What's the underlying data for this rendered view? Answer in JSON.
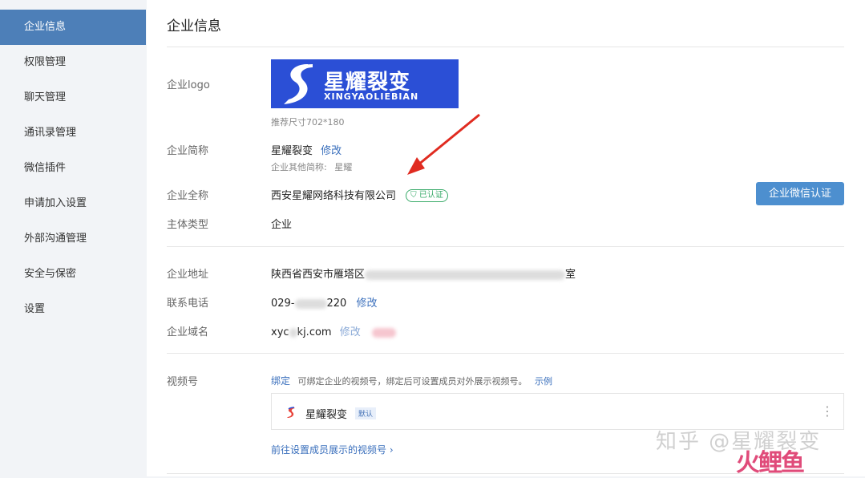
{
  "sidebar": {
    "items": [
      {
        "label": "企业信息"
      },
      {
        "label": "权限管理"
      },
      {
        "label": "聊天管理"
      },
      {
        "label": "通讯录管理"
      },
      {
        "label": "微信插件"
      },
      {
        "label": "申请加入设置"
      },
      {
        "label": "外部沟通管理"
      },
      {
        "label": "安全与保密"
      },
      {
        "label": "设置"
      }
    ],
    "active_index": 0
  },
  "page": {
    "title": "企业信息"
  },
  "logo": {
    "label": "企业logo",
    "brand_cn": "星耀裂变",
    "brand_en": "XINGYAOLIEBIAN",
    "size_hint": "推荐尺寸702*180"
  },
  "short_name": {
    "label": "企业简称",
    "value": "星耀裂变",
    "edit": "修改",
    "other_label": "企业其他简称:",
    "other_value": "星耀"
  },
  "full_name": {
    "label": "企业全称",
    "value": "西安星耀网络科技有限公司",
    "badge": "已认证",
    "cert_button": "企业微信认证"
  },
  "entity_type": {
    "label": "主体类型",
    "value": "企业"
  },
  "address": {
    "label": "企业地址",
    "value_start": "陕西省西安市雁塔区",
    "value_end": "室"
  },
  "phone": {
    "label": "联系电话",
    "value_start": "029-",
    "value_end": "220",
    "edit": "修改"
  },
  "domain": {
    "label": "企业域名",
    "value_start": "xyc",
    "value_mid": "kj.com",
    "edit": "修改"
  },
  "channel": {
    "label": "视频号",
    "bind": "绑定",
    "description": "可绑定企业的视频号，绑定后可设置成员对外展示视频号。",
    "example": "示例",
    "card_name": "星耀裂变",
    "card_badge": "默认",
    "footer_link": "前往设置成员展示的视频号"
  },
  "watermark": {
    "text": "知乎 @星耀裂变",
    "brand": "火鲤鱼"
  },
  "colors": {
    "active_nav": "#4d7fb8",
    "link": "#3a6fbc",
    "verified": "#3aab6a",
    "button": "#4d8fcf",
    "arrow": "#e02b20"
  }
}
